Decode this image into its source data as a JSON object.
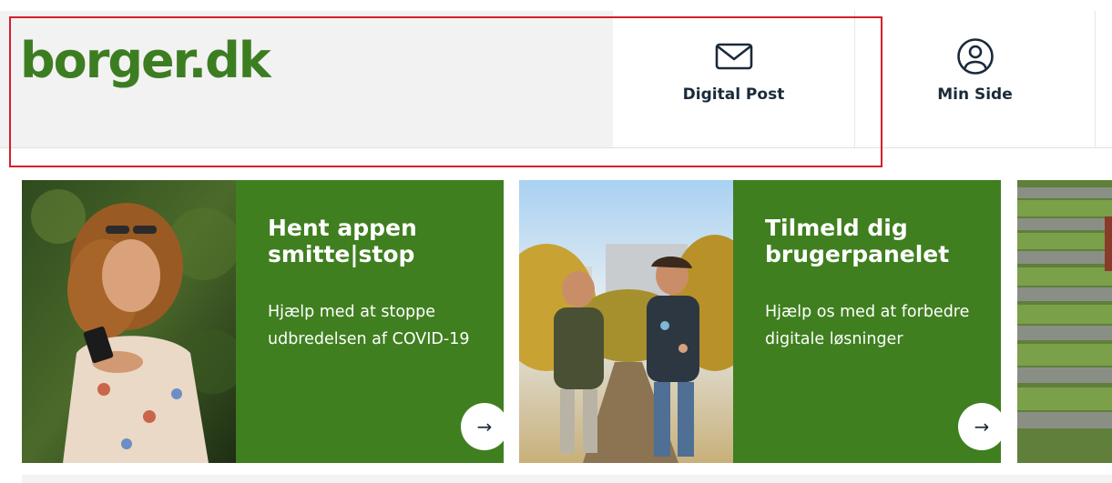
{
  "header": {
    "logo_text": "borger.dk",
    "nav": [
      {
        "label": "Digital Post",
        "icon": "envelope-icon"
      },
      {
        "label": "Min Side",
        "icon": "user-circle-icon"
      }
    ]
  },
  "cards": [
    {
      "title": "Hent appen smitte|stop",
      "text": "Hjælp med at stoppe udbredelsen af COVID-19",
      "button_icon": "→"
    },
    {
      "title": "Tilmeld dig brugerpanelet",
      "text": "Hjælp os med at forbedre digitale løsninger",
      "button_icon": "→"
    }
  ],
  "colors": {
    "brand_green": "#3f7f1f",
    "logo_green": "#3d7d22",
    "highlight_red": "#d4202b",
    "header_bg": "#f2f2f2",
    "nav_text": "#1a2a3a"
  }
}
